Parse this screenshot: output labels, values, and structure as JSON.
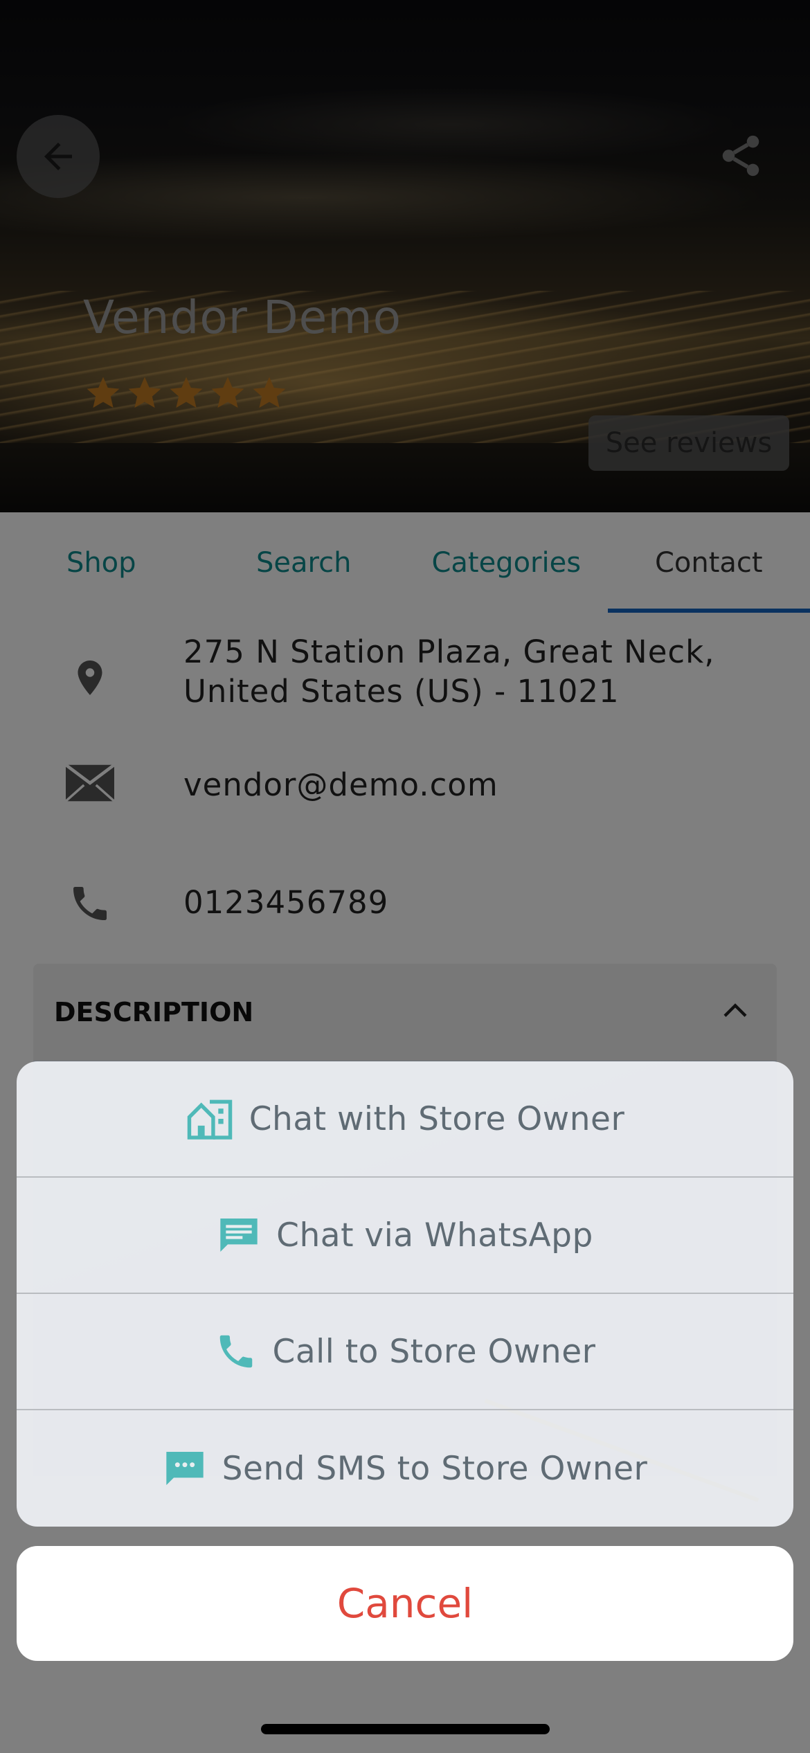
{
  "store": {
    "name": "Vendor Demo",
    "rating": 5,
    "see_reviews_label": "See reviews"
  },
  "header": {
    "back_icon": "arrow-left-icon",
    "share_icon": "share-icon"
  },
  "tabs": [
    {
      "label": "Shop",
      "active": false
    },
    {
      "label": "Search",
      "active": false
    },
    {
      "label": "Categories",
      "active": false
    },
    {
      "label": "Contact",
      "active": true
    }
  ],
  "contact": {
    "address_line1": "275 N Station Plaza, Great Neck,",
    "address_line2": "United States (US) - 11021",
    "email": "vendor@demo.com",
    "phone": "0123456789"
  },
  "description": {
    "heading": "DESCRIPTION"
  },
  "action_sheet": {
    "items": [
      {
        "label": "Chat with Store Owner",
        "icon": "store-chat-icon"
      },
      {
        "label": "Chat via WhatsApp",
        "icon": "message-icon"
      },
      {
        "label": "Call to Store Owner",
        "icon": "phone-icon"
      },
      {
        "label": "Send SMS to Store Owner",
        "icon": "sms-icon"
      }
    ],
    "cancel_label": "Cancel"
  },
  "colors": {
    "accent": "#0f8a8c",
    "tab_indicator": "#1565c0",
    "star": "#d98a28",
    "icon_teal": "#4fb9b8",
    "cancel": "#e0493d"
  }
}
